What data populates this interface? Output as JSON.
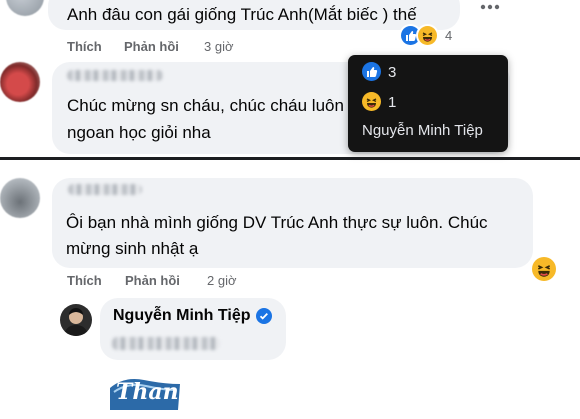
{
  "comment1": {
    "text": "Anh đâu con gái giống Trúc Anh(Mắt biếc ) thế",
    "like_label": "Thích",
    "reply_label": "Phản hồi",
    "time": "3 giờ",
    "reaction_count": "4",
    "reactions": [
      "like-icon",
      "haha-icon"
    ]
  },
  "comment2": {
    "text_line1": "Chúc mừng sn cháu, chúc cháu luôn mạnh khỏe, chăm",
    "text_line2": "ngoan học giỏi nha"
  },
  "tooltip": {
    "like_count": "3",
    "haha_count": "1",
    "reactor_name": "Nguyễn Minh Tiệp"
  },
  "comment3": {
    "text_line1": "Ôi bạn nhà mình giống DV Trúc Anh thực sự luôn. Chúc",
    "text_line2": "mừng sinh nhật ạ",
    "like_label": "Thích",
    "reply_label": "Phản hồi",
    "time": "2 giờ",
    "reaction": "haha-icon"
  },
  "reply": {
    "author": "Nguyễn Minh Tiệp",
    "verified_icon": "verified-badge-icon",
    "sticker_text": "Thank"
  },
  "colors": {
    "bubble": "#f0f2f5",
    "tooltip_bg": "#141414",
    "like_blue": "#1b74e4",
    "haha_yellow": "#f7b928",
    "action_gray": "#65676b"
  }
}
